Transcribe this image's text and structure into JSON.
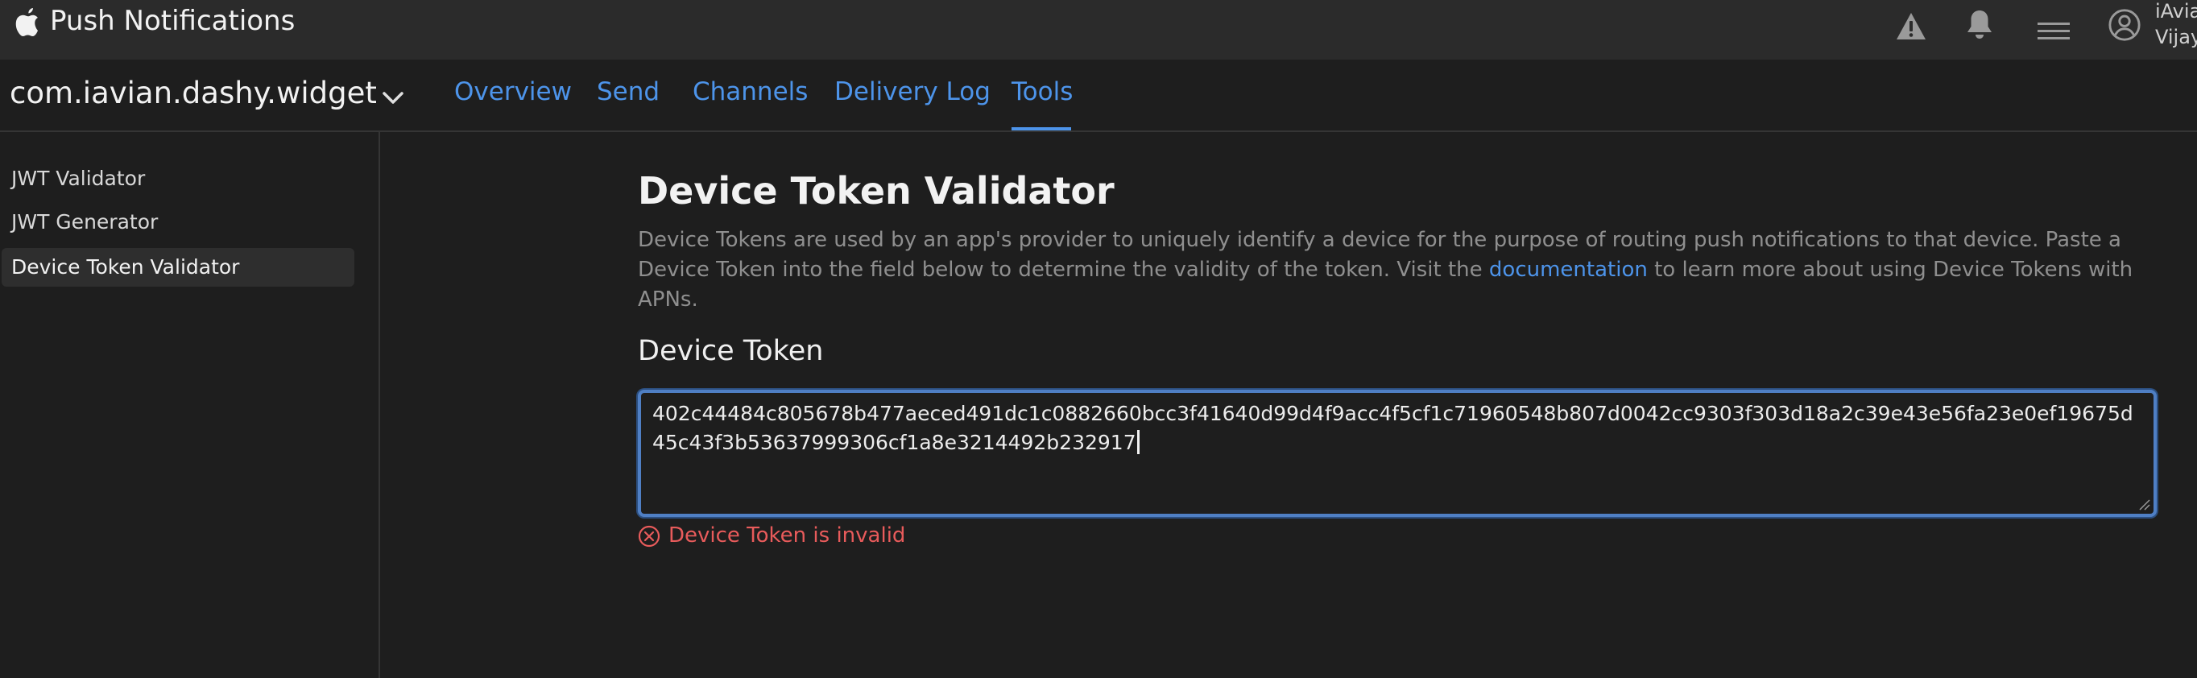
{
  "header": {
    "app_title": "Push Notifications",
    "user": {
      "name_line1": "iAvia",
      "name_line2": "Vijay"
    },
    "icons": [
      "apple-logo",
      "warning-icon",
      "bell-icon",
      "menu-icon",
      "user-circle-icon"
    ]
  },
  "subheader": {
    "bundle_id": "com.iavian.dashy.widget",
    "tabs": [
      {
        "label": "Overview"
      },
      {
        "label": "Send"
      },
      {
        "label": "Channels"
      },
      {
        "label": "Delivery Log"
      },
      {
        "label": "Tools",
        "active": true
      }
    ]
  },
  "sidebar": {
    "items": [
      {
        "label": "JWT Validator"
      },
      {
        "label": "JWT Generator"
      },
      {
        "label": "Device Token Validator",
        "active": true
      }
    ]
  },
  "main": {
    "title": "Device Token Validator",
    "description_before_link": "Device Tokens are used by an app's provider to uniquely identify a device for the purpose of routing push notifications to that device. Paste a Device Token into the field below to determine the validity of the token. Visit the ",
    "link_text": "documentation",
    "description_after_link": " to learn more about using Device Tokens with APNs.",
    "field_label": "Device Token",
    "token_value": "402c44484c805678b477aeced491dc1c0882660bcc3f41640d99d4f9acc4f5cf1c71960548b807d0042cc9303f303d18a2c39e43e56fa23e0ef19675d45c43f3b53637999306cf1a8e3214492b232917",
    "error_message": "Device Token is invalid"
  },
  "colors": {
    "accent": "#4d94ea",
    "error": "#e85b5b",
    "background": "#1e1e1e",
    "topbar": "#2b2b2b"
  }
}
